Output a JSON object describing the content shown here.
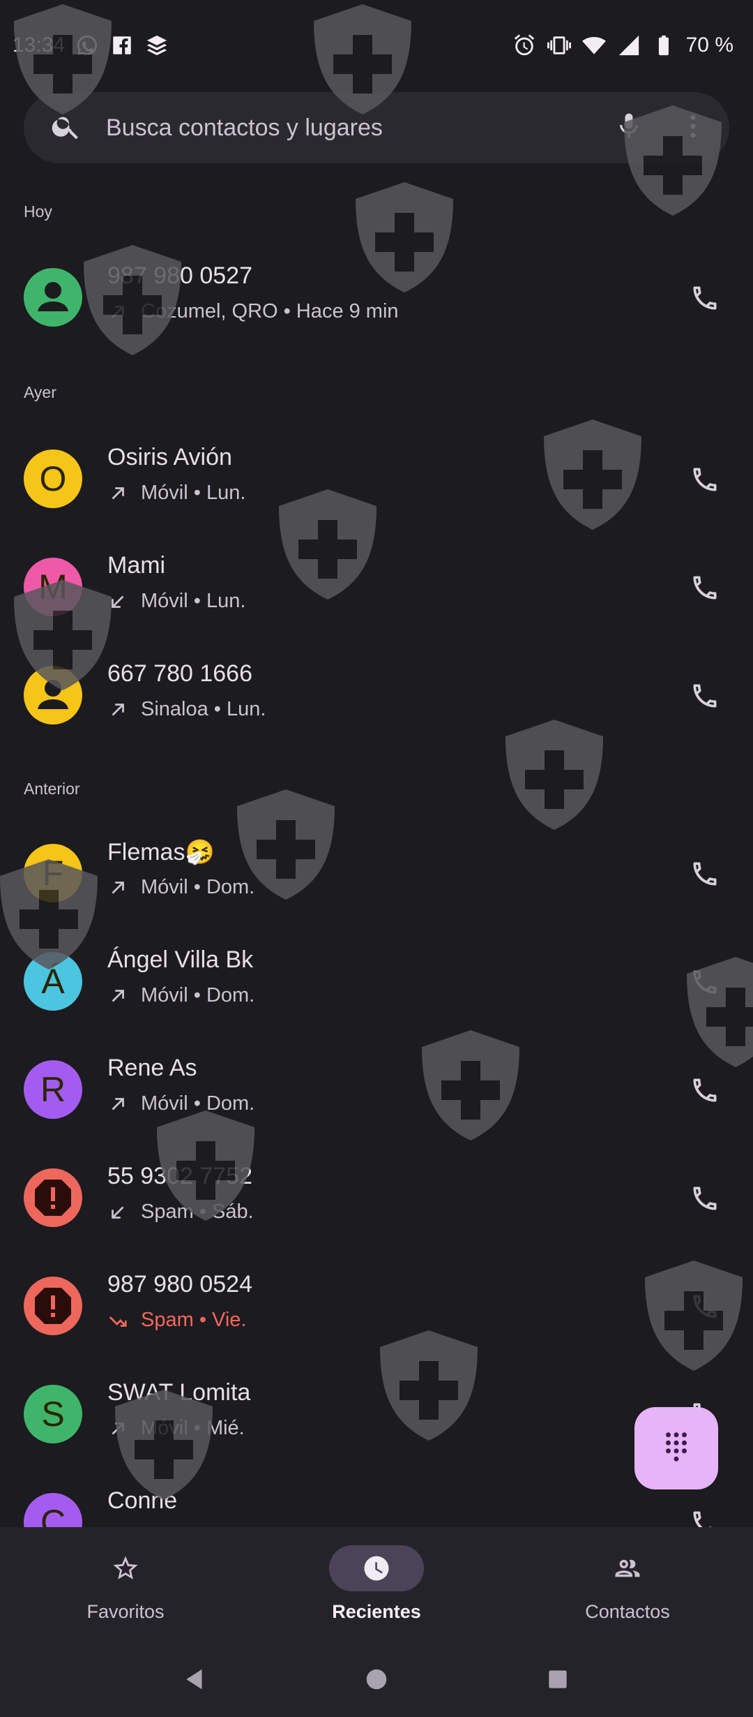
{
  "status_bar": {
    "time": "13:34",
    "battery": "70 %",
    "left_icons": [
      "whatsapp-icon",
      "facebook-icon",
      "buffer-icon"
    ],
    "right_icons": [
      "alarm-icon",
      "vibrate-icon",
      "wifi-icon",
      "signal-icon",
      "battery-icon"
    ]
  },
  "search": {
    "placeholder": "Busca contactos y lugares"
  },
  "sections": [
    {
      "header": "Hoy",
      "calls": [
        {
          "name": "987 980 0527",
          "direction": "outgoing",
          "detail": "Cozumel, QRO • Hace 9 min",
          "avatar_type": "person",
          "avatar_color": "#3fb56b",
          "letter": ""
        }
      ]
    },
    {
      "header": "Ayer",
      "calls": [
        {
          "name": "Osiris Avión",
          "direction": "outgoing",
          "detail": "Móvil • Lun.",
          "avatar_type": "letter",
          "avatar_color": "#f5c518",
          "letter": "O"
        },
        {
          "name": "Mami",
          "direction": "incoming",
          "detail": "Móvil • Lun.",
          "avatar_type": "letter",
          "avatar_color": "#ee5aa8",
          "letter": "M"
        },
        {
          "name": "667 780 1666",
          "direction": "outgoing",
          "detail": "Sinaloa • Lun.",
          "avatar_type": "person",
          "avatar_color": "#f5c518",
          "letter": ""
        }
      ]
    },
    {
      "header": "Anterior",
      "calls": [
        {
          "name": "Flemas🤧",
          "direction": "outgoing",
          "detail": "Móvil • Dom.",
          "avatar_type": "letter",
          "avatar_color": "#f5c518",
          "letter": "F"
        },
        {
          "name": "Ángel Villa Bk",
          "direction": "outgoing",
          "detail": "Móvil • Dom.",
          "avatar_type": "letter",
          "avatar_color": "#4cc5e0",
          "letter": "Á"
        },
        {
          "name": "Rene As",
          "direction": "outgoing",
          "detail": "Móvil • Dom.",
          "avatar_type": "letter",
          "avatar_color": "#a45cf0",
          "letter": "R"
        },
        {
          "name": "55 9302 7752",
          "direction": "incoming",
          "detail": "Spam • Sáb.",
          "avatar_type": "spam",
          "avatar_color": "#ee675c",
          "letter": ""
        },
        {
          "name": "987 980 0524",
          "direction": "missed",
          "detail": "Spam • Vie.",
          "avatar_type": "spam",
          "avatar_color": "#ee675c",
          "letter": ""
        },
        {
          "name": "SWAT Lomita",
          "direction": "outgoing",
          "detail": "Móvil • Mié.",
          "avatar_type": "letter",
          "avatar_color": "#3fb56b",
          "letter": "S"
        },
        {
          "name": "Conne",
          "direction": "outgoing",
          "detail": "",
          "avatar_type": "letter",
          "avatar_color": "#a45cf0",
          "letter": "C"
        }
      ]
    }
  ],
  "nav": {
    "favorites": "Favoritos",
    "recents": "Recientes",
    "contacts": "Contactos",
    "active": "recents"
  },
  "colors": {
    "background": "#1c1b1f",
    "spam_text": "#f2685c",
    "fab": "#e8b4f8"
  }
}
